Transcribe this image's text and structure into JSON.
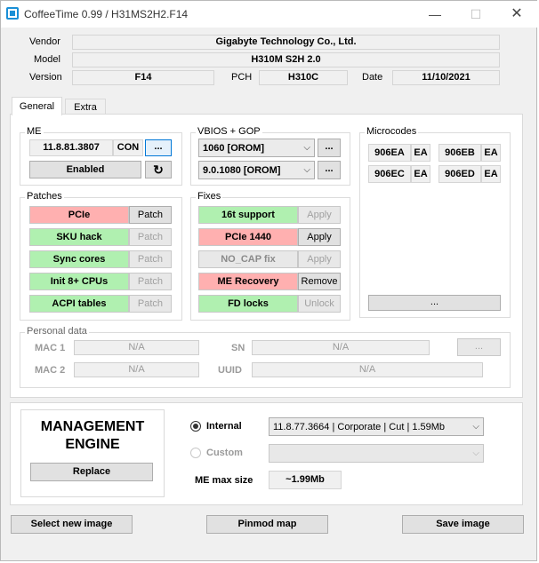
{
  "window": {
    "title": "CoffeeTime 0.99  /  H31MS2H2.F14",
    "controls": {
      "minimize": "—",
      "maximize": "☐",
      "close": "✕"
    }
  },
  "info": {
    "vendor_label": "Vendor",
    "vendor": "Gigabyte Technology Co., Ltd.",
    "model_label": "Model",
    "model": "H310M S2H 2.0",
    "version_label": "Version",
    "version": "F14",
    "pch_label": "PCH",
    "pch": "H310C",
    "date_label": "Date",
    "date": "11/10/2021"
  },
  "tabs": [
    {
      "label": "General"
    },
    {
      "label": "Extra"
    }
  ],
  "me": {
    "title": "ME",
    "version": "11.8.81.3807",
    "con": "CON",
    "more": "...",
    "state": "Enabled",
    "refresh_icon": "↻"
  },
  "vbios": {
    "title": "VBIOS + GOP",
    "vbios_value": "1060 [OROM]",
    "gop_value": "9.0.1080 [OROM]",
    "more1": "...",
    "more2": "...",
    "arrow": "⌵"
  },
  "microcodes": {
    "title": "Microcodes",
    "items": [
      {
        "id": "906EA",
        "tag": "EA"
      },
      {
        "id": "906EB",
        "tag": "EA"
      },
      {
        "id": "906EC",
        "tag": "EA"
      },
      {
        "id": "906ED",
        "tag": "EA"
      }
    ],
    "more": "..."
  },
  "patches": {
    "title": "Patches",
    "items": [
      {
        "label": "PCIe",
        "state": "red",
        "action": "Patch",
        "action_enabled": true
      },
      {
        "label": "SKU hack",
        "state": "green",
        "action": "Patch",
        "action_enabled": false
      },
      {
        "label": "Sync cores",
        "state": "green",
        "action": "Patch",
        "action_enabled": false
      },
      {
        "label": "Init 8+ CPUs",
        "state": "green",
        "action": "Patch",
        "action_enabled": false
      },
      {
        "label": "ACPI tables",
        "state": "green",
        "action": "Patch",
        "action_enabled": false
      }
    ]
  },
  "fixes": {
    "title": "Fixes",
    "items": [
      {
        "label": "16t support",
        "state": "green",
        "action": "Apply",
        "action_enabled": false
      },
      {
        "label": "PCIe 1440",
        "state": "red",
        "action": "Apply",
        "action_enabled": true
      },
      {
        "label": "NO_CAP fix",
        "state": "gray",
        "action": "Apply",
        "action_enabled": false
      },
      {
        "label": "ME Recovery",
        "state": "red",
        "action": "Remove",
        "action_enabled": true
      },
      {
        "label": "FD locks",
        "state": "green",
        "action": "Unlock",
        "action_enabled": false
      }
    ]
  },
  "personal": {
    "title": "Personal data",
    "mac1_label": "MAC 1",
    "mac1": "N/A",
    "mac2_label": "MAC 2",
    "mac2": "N/A",
    "sn_label": "SN",
    "sn": "N/A",
    "uuid_label": "UUID",
    "uuid": "N/A",
    "more": "..."
  },
  "management": {
    "heading_line1": "MANAGEMENT",
    "heading_line2": "ENGINE",
    "replace": "Replace",
    "internal_label": "Internal",
    "internal_value": "11.8.77.3664 | Corporate | Cut | 1.59Mb",
    "custom_label": "Custom",
    "custom_value": "",
    "max_size_label": "ME max size",
    "max_size_value": "~1.99Mb",
    "selected": "internal"
  },
  "footer": {
    "select_image": "Select new image",
    "pinmod_map": "Pinmod map",
    "save_image": "Save image"
  },
  "colors": {
    "green": "#b0f0b0",
    "red": "#ffb0b0",
    "accent": "#0078d7"
  }
}
